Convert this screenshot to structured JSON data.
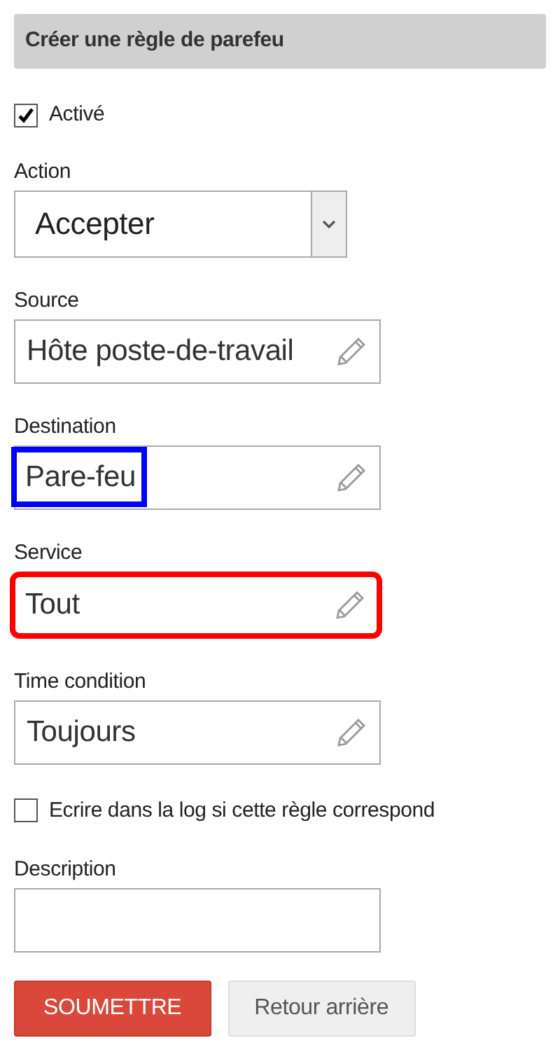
{
  "header": {
    "title": "Créer une règle de parefeu"
  },
  "fields": [
    {
      "kind": "checkbox",
      "label": "Activé",
      "checked": true
    },
    {
      "kind": "select",
      "label": "Action",
      "value": "Accepter"
    },
    {
      "kind": "picker",
      "label": "Source",
      "value": "Hôte poste-de-travail"
    },
    {
      "kind": "picker",
      "label": "Destination",
      "value": "Pare-feu",
      "highlight": {
        "kind": "value",
        "color": "#0000ff"
      }
    },
    {
      "kind": "picker",
      "label": "Service",
      "value": "Tout",
      "highlight": {
        "kind": "field",
        "color": "#ff0000"
      }
    },
    {
      "kind": "picker",
      "label": "Time condition",
      "value": "Toujours"
    },
    {
      "kind": "checkbox",
      "label": "Ecrire dans la log si cette règle correspond",
      "checked": false
    },
    {
      "kind": "text",
      "label": "Description"
    }
  ],
  "buttons": [
    {
      "kind": "primary",
      "label": "SOUMETTRE"
    },
    {
      "kind": "secondary",
      "label": "Retour arrière"
    }
  ]
}
